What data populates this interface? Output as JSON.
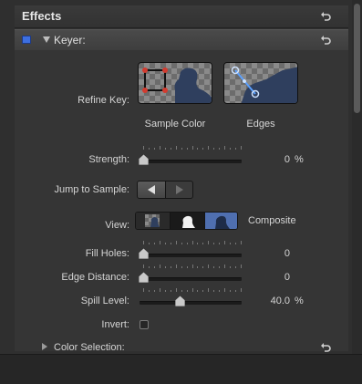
{
  "header": {
    "title": "Effects"
  },
  "keyer": {
    "label": "Keyer:"
  },
  "refine_key": {
    "label": "Refine Key:",
    "sample_color": "Sample Color",
    "edges": "Edges"
  },
  "strength": {
    "label": "Strength:",
    "value": "0",
    "unit": "%",
    "level": 0
  },
  "jump_to_sample": {
    "label": "Jump to Sample:"
  },
  "view": {
    "label": "View:",
    "mode": "Composite"
  },
  "fill_holes": {
    "label": "Fill Holes:",
    "value": "0",
    "level": 0
  },
  "edge_distance": {
    "label": "Edge Distance:",
    "value": "0",
    "level": 0
  },
  "spill_level": {
    "label": "Spill Level:",
    "value": "40.0",
    "unit": "%",
    "level": 0.4
  },
  "invert": {
    "label": "Invert:",
    "checked": false
  },
  "color_selection": {
    "label": "Color Selection:"
  },
  "colors": {
    "accent": "#3d6fe0"
  }
}
